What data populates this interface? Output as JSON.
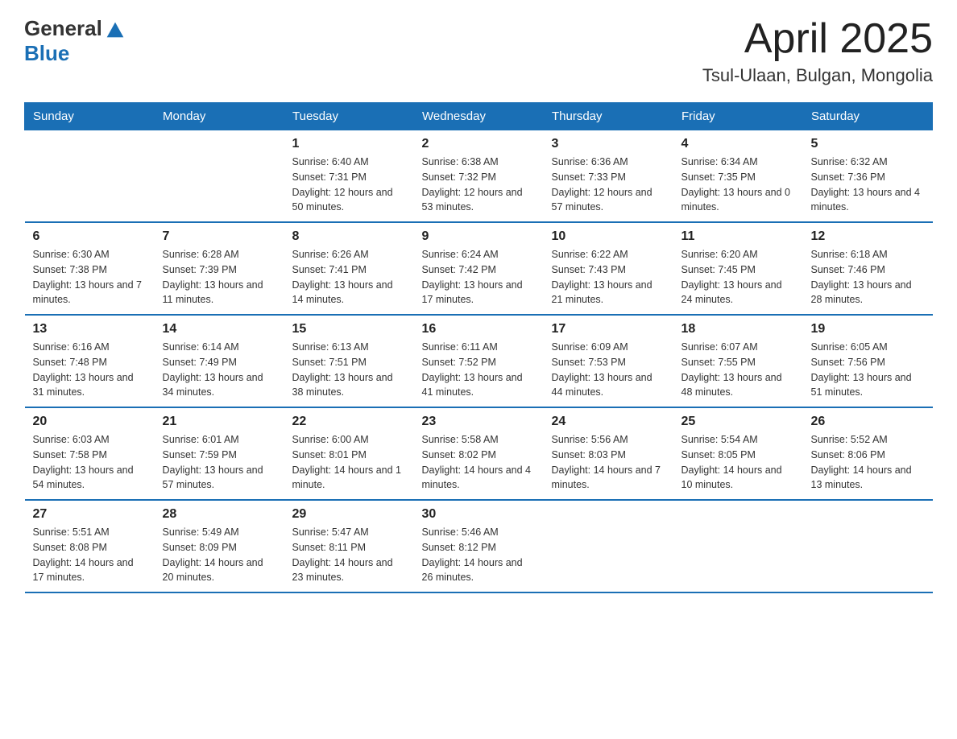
{
  "header": {
    "logo": {
      "general": "General",
      "blue": "Blue"
    },
    "title": "April 2025",
    "location": "Tsul-Ulaan, Bulgan, Mongolia"
  },
  "days_of_week": [
    "Sunday",
    "Monday",
    "Tuesday",
    "Wednesday",
    "Thursday",
    "Friday",
    "Saturday"
  ],
  "weeks": [
    [
      {
        "day": "",
        "sunrise": "",
        "sunset": "",
        "daylight": ""
      },
      {
        "day": "",
        "sunrise": "",
        "sunset": "",
        "daylight": ""
      },
      {
        "day": "1",
        "sunrise": "Sunrise: 6:40 AM",
        "sunset": "Sunset: 7:31 PM",
        "daylight": "Daylight: 12 hours and 50 minutes."
      },
      {
        "day": "2",
        "sunrise": "Sunrise: 6:38 AM",
        "sunset": "Sunset: 7:32 PM",
        "daylight": "Daylight: 12 hours and 53 minutes."
      },
      {
        "day": "3",
        "sunrise": "Sunrise: 6:36 AM",
        "sunset": "Sunset: 7:33 PM",
        "daylight": "Daylight: 12 hours and 57 minutes."
      },
      {
        "day": "4",
        "sunrise": "Sunrise: 6:34 AM",
        "sunset": "Sunset: 7:35 PM",
        "daylight": "Daylight: 13 hours and 0 minutes."
      },
      {
        "day": "5",
        "sunrise": "Sunrise: 6:32 AM",
        "sunset": "Sunset: 7:36 PM",
        "daylight": "Daylight: 13 hours and 4 minutes."
      }
    ],
    [
      {
        "day": "6",
        "sunrise": "Sunrise: 6:30 AM",
        "sunset": "Sunset: 7:38 PM",
        "daylight": "Daylight: 13 hours and 7 minutes."
      },
      {
        "day": "7",
        "sunrise": "Sunrise: 6:28 AM",
        "sunset": "Sunset: 7:39 PM",
        "daylight": "Daylight: 13 hours and 11 minutes."
      },
      {
        "day": "8",
        "sunrise": "Sunrise: 6:26 AM",
        "sunset": "Sunset: 7:41 PM",
        "daylight": "Daylight: 13 hours and 14 minutes."
      },
      {
        "day": "9",
        "sunrise": "Sunrise: 6:24 AM",
        "sunset": "Sunset: 7:42 PM",
        "daylight": "Daylight: 13 hours and 17 minutes."
      },
      {
        "day": "10",
        "sunrise": "Sunrise: 6:22 AM",
        "sunset": "Sunset: 7:43 PM",
        "daylight": "Daylight: 13 hours and 21 minutes."
      },
      {
        "day": "11",
        "sunrise": "Sunrise: 6:20 AM",
        "sunset": "Sunset: 7:45 PM",
        "daylight": "Daylight: 13 hours and 24 minutes."
      },
      {
        "day": "12",
        "sunrise": "Sunrise: 6:18 AM",
        "sunset": "Sunset: 7:46 PM",
        "daylight": "Daylight: 13 hours and 28 minutes."
      }
    ],
    [
      {
        "day": "13",
        "sunrise": "Sunrise: 6:16 AM",
        "sunset": "Sunset: 7:48 PM",
        "daylight": "Daylight: 13 hours and 31 minutes."
      },
      {
        "day": "14",
        "sunrise": "Sunrise: 6:14 AM",
        "sunset": "Sunset: 7:49 PM",
        "daylight": "Daylight: 13 hours and 34 minutes."
      },
      {
        "day": "15",
        "sunrise": "Sunrise: 6:13 AM",
        "sunset": "Sunset: 7:51 PM",
        "daylight": "Daylight: 13 hours and 38 minutes."
      },
      {
        "day": "16",
        "sunrise": "Sunrise: 6:11 AM",
        "sunset": "Sunset: 7:52 PM",
        "daylight": "Daylight: 13 hours and 41 minutes."
      },
      {
        "day": "17",
        "sunrise": "Sunrise: 6:09 AM",
        "sunset": "Sunset: 7:53 PM",
        "daylight": "Daylight: 13 hours and 44 minutes."
      },
      {
        "day": "18",
        "sunrise": "Sunrise: 6:07 AM",
        "sunset": "Sunset: 7:55 PM",
        "daylight": "Daylight: 13 hours and 48 minutes."
      },
      {
        "day": "19",
        "sunrise": "Sunrise: 6:05 AM",
        "sunset": "Sunset: 7:56 PM",
        "daylight": "Daylight: 13 hours and 51 minutes."
      }
    ],
    [
      {
        "day": "20",
        "sunrise": "Sunrise: 6:03 AM",
        "sunset": "Sunset: 7:58 PM",
        "daylight": "Daylight: 13 hours and 54 minutes."
      },
      {
        "day": "21",
        "sunrise": "Sunrise: 6:01 AM",
        "sunset": "Sunset: 7:59 PM",
        "daylight": "Daylight: 13 hours and 57 minutes."
      },
      {
        "day": "22",
        "sunrise": "Sunrise: 6:00 AM",
        "sunset": "Sunset: 8:01 PM",
        "daylight": "Daylight: 14 hours and 1 minute."
      },
      {
        "day": "23",
        "sunrise": "Sunrise: 5:58 AM",
        "sunset": "Sunset: 8:02 PM",
        "daylight": "Daylight: 14 hours and 4 minutes."
      },
      {
        "day": "24",
        "sunrise": "Sunrise: 5:56 AM",
        "sunset": "Sunset: 8:03 PM",
        "daylight": "Daylight: 14 hours and 7 minutes."
      },
      {
        "day": "25",
        "sunrise": "Sunrise: 5:54 AM",
        "sunset": "Sunset: 8:05 PM",
        "daylight": "Daylight: 14 hours and 10 minutes."
      },
      {
        "day": "26",
        "sunrise": "Sunrise: 5:52 AM",
        "sunset": "Sunset: 8:06 PM",
        "daylight": "Daylight: 14 hours and 13 minutes."
      }
    ],
    [
      {
        "day": "27",
        "sunrise": "Sunrise: 5:51 AM",
        "sunset": "Sunset: 8:08 PM",
        "daylight": "Daylight: 14 hours and 17 minutes."
      },
      {
        "day": "28",
        "sunrise": "Sunrise: 5:49 AM",
        "sunset": "Sunset: 8:09 PM",
        "daylight": "Daylight: 14 hours and 20 minutes."
      },
      {
        "day": "29",
        "sunrise": "Sunrise: 5:47 AM",
        "sunset": "Sunset: 8:11 PM",
        "daylight": "Daylight: 14 hours and 23 minutes."
      },
      {
        "day": "30",
        "sunrise": "Sunrise: 5:46 AM",
        "sunset": "Sunset: 8:12 PM",
        "daylight": "Daylight: 14 hours and 26 minutes."
      },
      {
        "day": "",
        "sunrise": "",
        "sunset": "",
        "daylight": ""
      },
      {
        "day": "",
        "sunrise": "",
        "sunset": "",
        "daylight": ""
      },
      {
        "day": "",
        "sunrise": "",
        "sunset": "",
        "daylight": ""
      }
    ]
  ]
}
